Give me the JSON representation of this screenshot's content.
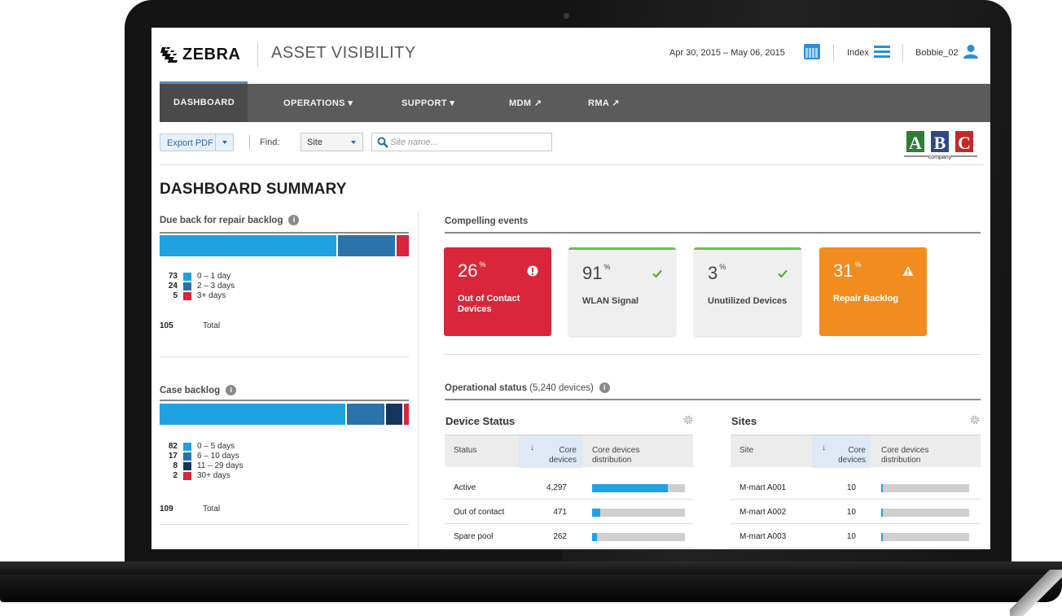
{
  "header": {
    "brand": "ZEBRA",
    "app_title": "ASSET VISIBILITY",
    "date_range": "Apr 30, 2015 – May 06, 2015",
    "index_label": "Index",
    "user_name": "Bobbie_02"
  },
  "nav": {
    "items": [
      {
        "label": "DASHBOARD"
      },
      {
        "label": "OPERATIONS ▾"
      },
      {
        "label": "SUPPORT ▾"
      },
      {
        "label": "MDM ↗"
      },
      {
        "label": "RMA ↗"
      }
    ]
  },
  "toolbar": {
    "export_label": "Export PDF",
    "find_label": "Find:",
    "find_scope": "Site",
    "search_placeholder": "Site name...",
    "company_logo_text": "ABC company"
  },
  "page_title": "DASHBOARD SUMMARY",
  "repair_backlog": {
    "title": "Due back for repair backlog",
    "legend": [
      {
        "count": "73",
        "label": "0 – 1 day",
        "color": "#1ea3e0"
      },
      {
        "count": "24",
        "label": "2 – 3 days",
        "color": "#2a73aa"
      },
      {
        "count": "5",
        "label": "3+ days",
        "color": "#d9263a"
      }
    ],
    "total": "105",
    "total_label": "Total"
  },
  "case_backlog": {
    "title": "Case backlog",
    "legend": [
      {
        "count": "82",
        "label": "0 – 5 days",
        "color": "#1ea3e0"
      },
      {
        "count": "17",
        "label": "6 – 10 days",
        "color": "#2a73aa"
      },
      {
        "count": "8",
        "label": "11 – 29 days",
        "color": "#16355c"
      },
      {
        "count": "2",
        "label": "30+ days",
        "color": "#d9263a"
      }
    ],
    "total": "109",
    "total_label": "Total"
  },
  "compelling_events": {
    "title": "Compelling events",
    "cards": [
      {
        "value": "26",
        "unit": "%",
        "label": "Out of Contact Devices",
        "status": "alert",
        "color": "#d9263a",
        "icon": "exclamation-circle-icon"
      },
      {
        "value": "91",
        "unit": "%",
        "label": "WLAN Signal",
        "status": "ok",
        "color": "#efefef",
        "icon": "checkmark-icon"
      },
      {
        "value": "3",
        "unit": "%",
        "label": "Unutilized Devices",
        "status": "ok",
        "color": "#efefef",
        "icon": "checkmark-icon"
      },
      {
        "value": "31",
        "unit": "%",
        "label": "Repair Backlog",
        "status": "warning",
        "color": "#f28c1e",
        "icon": "warning-triangle-icon"
      }
    ]
  },
  "operational_status": {
    "title": "Operational status",
    "device_total": "(5,240 devices)"
  },
  "device_status_table": {
    "title": "Device Status",
    "columns": [
      "Status",
      "Core devices",
      "Core devices distribution"
    ],
    "rows": [
      {
        "status": "Active",
        "core_devices": "4,297",
        "distribution": 0.82
      },
      {
        "status": "Out of contact",
        "core_devices": "471",
        "distribution": 0.09
      },
      {
        "status": "Spare pool",
        "core_devices": "262",
        "distribution": 0.05
      }
    ]
  },
  "sites_table": {
    "title": "Sites",
    "columns": [
      "Site",
      "Core devices",
      "Core devices distribution"
    ],
    "rows": [
      {
        "site": "M-mart A001",
        "core_devices": "10",
        "distribution": 0.01
      },
      {
        "site": "M-mart A002",
        "core_devices": "10",
        "distribution": 0.01
      },
      {
        "site": "M-mart A003",
        "core_devices": "10",
        "distribution": 0.01
      }
    ]
  },
  "colors": {
    "accent": "#2a8fd8",
    "nav_bg": "#5b5b5b",
    "ok": "#6cc04a",
    "alert": "#d9263a",
    "warning": "#f28c1e"
  }
}
